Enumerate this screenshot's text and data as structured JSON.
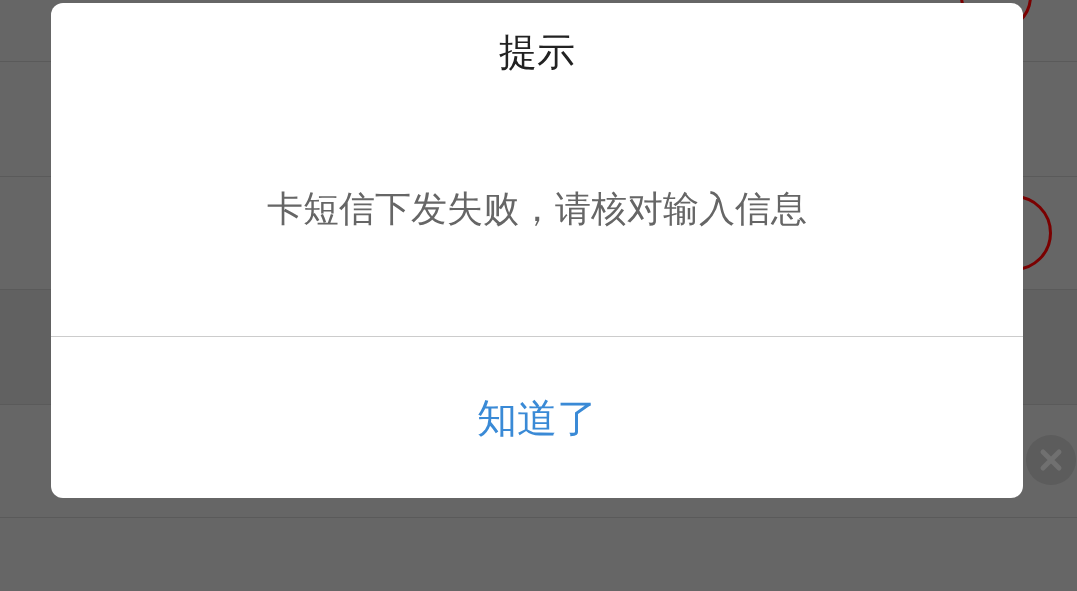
{
  "dialog": {
    "title": "提示",
    "message": "卡短信下发失败，请核对输入信息",
    "buttons": [
      "知道了"
    ]
  }
}
